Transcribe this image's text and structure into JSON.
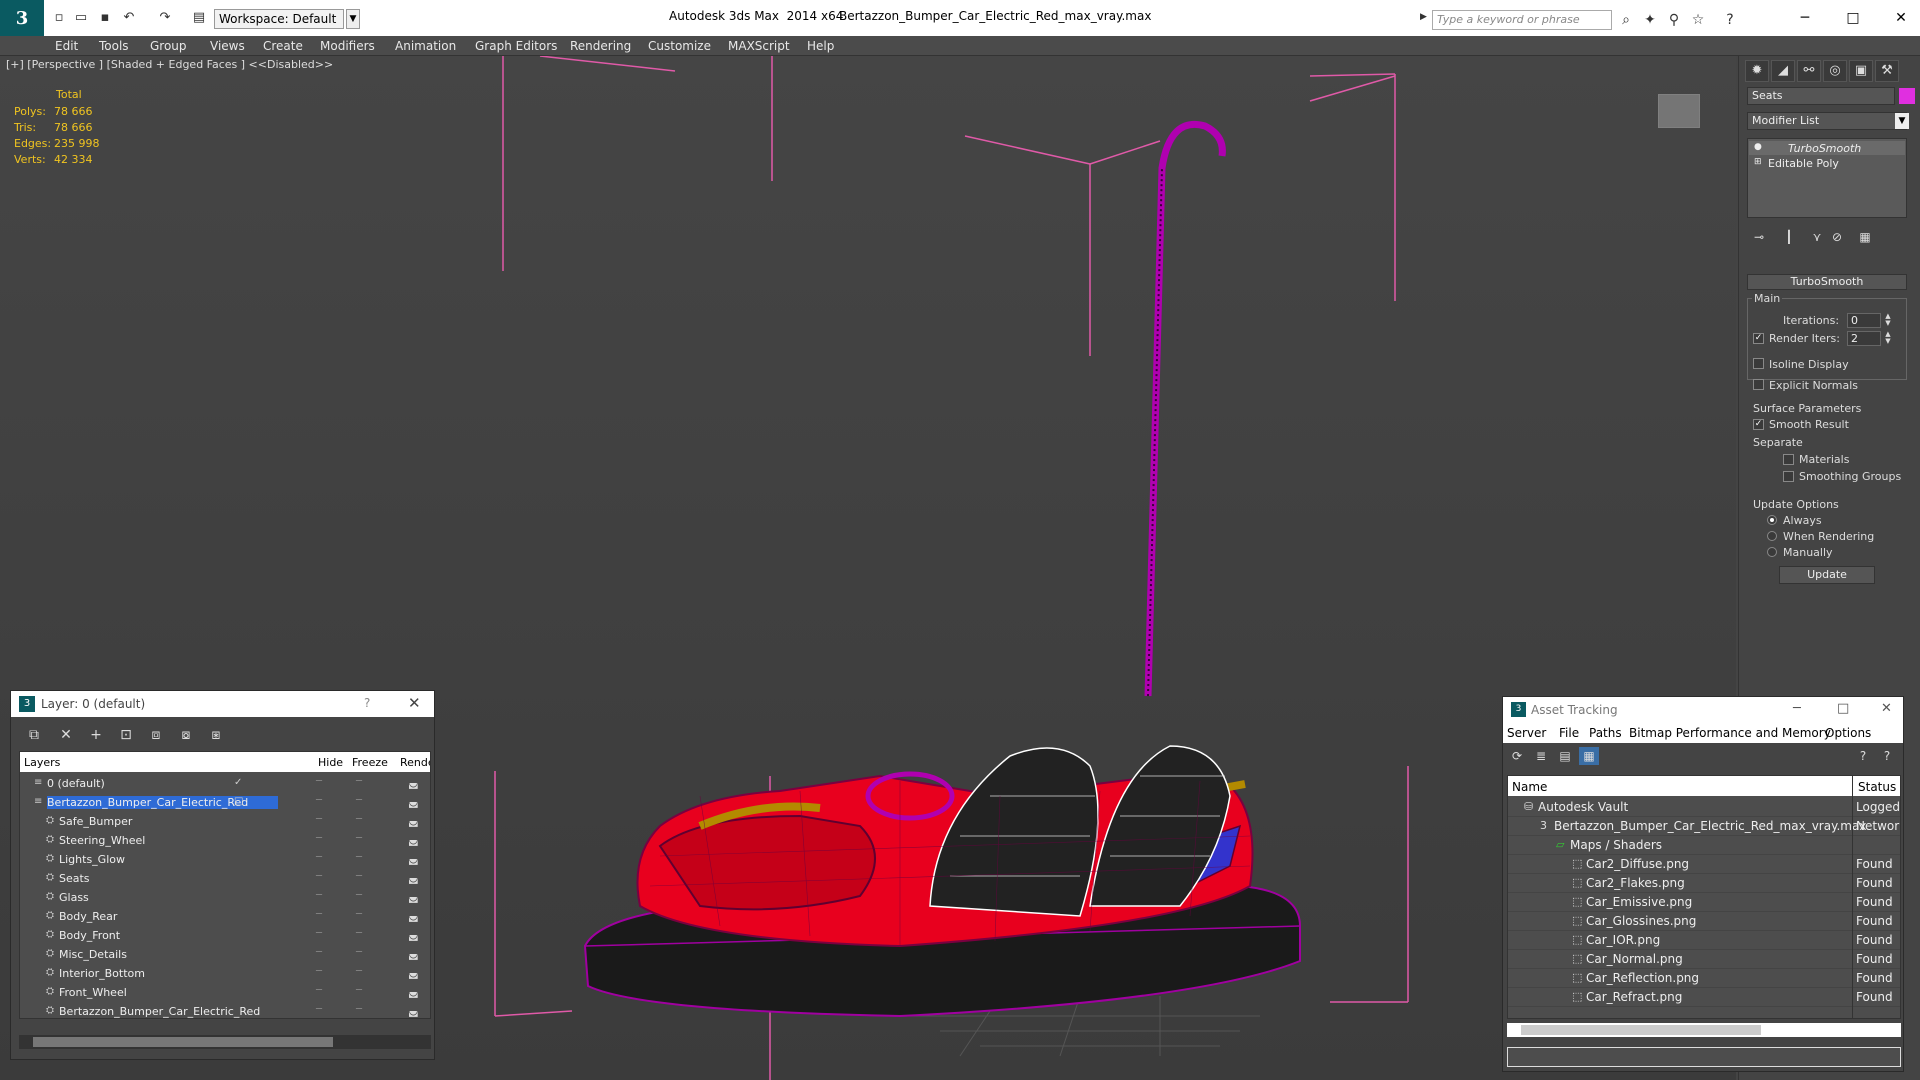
{
  "titlebar": {
    "workspace": "Workspace: Default",
    "app_title": "Autodesk 3ds Max  2014 x64",
    "file_name": "Bertazzon_Bumper_Car_Electric_Red_max_vray.max",
    "search_placeholder": "Type a keyword or phrase"
  },
  "menu": [
    "Edit",
    "Tools",
    "Group",
    "Views",
    "Create",
    "Modifiers",
    "Animation",
    "Graph Editors",
    "Rendering",
    "Customize",
    "MAXScript",
    "Help"
  ],
  "viewport": {
    "label": "[+] [Perspective ] [Shaded + Edged Faces ]  <<Disabled>>",
    "stats_total": "Total",
    "stats": [
      {
        "label": "Polys:",
        "value": "78 666"
      },
      {
        "label": "Tris:",
        "value": "78 666"
      },
      {
        "label": "Edges:",
        "value": "235 998"
      },
      {
        "label": "Verts:",
        "value": "42 334"
      }
    ]
  },
  "command_panel": {
    "object_name": "Seats",
    "object_color": "#e02fe0",
    "modifier_list": "Modifier List",
    "stack": [
      "TurboSmooth",
      "Editable Poly"
    ],
    "rollout_title": "TurboSmooth",
    "main_group": "Main",
    "iterations_label": "Iterations:",
    "iterations_value": "0",
    "render_iters_label": "Render Iters:",
    "render_iters_value": "2",
    "render_iters_checked": true,
    "isoline_label": "Isoline Display",
    "explicit_normals_label": "Explicit Normals",
    "surface_group": "Surface Parameters",
    "smooth_result_label": "Smooth Result",
    "smooth_result_checked": true,
    "separate_label": "Separate",
    "materials_label": "Materials",
    "smoothing_groups_label": "Smoothing Groups",
    "update_group": "Update Options",
    "update_options": [
      "Always",
      "When Rendering",
      "Manually"
    ],
    "update_selected": "Always",
    "update_button": "Update"
  },
  "layer_dialog": {
    "title": "Layer: 0 (default)",
    "help": "?",
    "columns": {
      "layers": "Layers",
      "hide": "Hide",
      "freeze": "Freeze",
      "render": "Render"
    },
    "rows": [
      {
        "name": "0 (default)",
        "level": 0,
        "active": true
      },
      {
        "name": "Bertazzon_Bumper_Car_Electric_Red",
        "level": 0,
        "selected": true
      },
      {
        "name": "Safe_Bumper",
        "level": 1
      },
      {
        "name": "Steering_Wheel",
        "level": 1
      },
      {
        "name": "Lights_Glow",
        "level": 1
      },
      {
        "name": "Seats",
        "level": 1
      },
      {
        "name": "Glass",
        "level": 1
      },
      {
        "name": "Body_Rear",
        "level": 1
      },
      {
        "name": "Body_Front",
        "level": 1
      },
      {
        "name": "Misc_Details",
        "level": 1
      },
      {
        "name": "Interior_Bottom",
        "level": 1
      },
      {
        "name": "Front_Wheel",
        "level": 1
      },
      {
        "name": "Bertazzon_Bumper_Car_Electric_Red",
        "level": 1
      }
    ]
  },
  "asset_dialog": {
    "title": "Asset Tracking",
    "menu": [
      "Server",
      "File",
      "Paths",
      "Bitmap Performance and Memory",
      "Options"
    ],
    "columns": {
      "name": "Name",
      "status": "Status"
    },
    "rows": [
      {
        "name": "Autodesk Vault",
        "status": "Logged C",
        "level": 0
      },
      {
        "name": "Bertazzon_Bumper_Car_Electric_Red_max_vray.max",
        "status": "Network I",
        "level": 1
      },
      {
        "name": "Maps / Shaders",
        "status": "",
        "level": 2
      },
      {
        "name": "Car2_Diffuse.png",
        "status": "Found",
        "level": 3
      },
      {
        "name": "Car2_Flakes.png",
        "status": "Found",
        "level": 3
      },
      {
        "name": "Car_Emissive.png",
        "status": "Found",
        "level": 3
      },
      {
        "name": "Car_Glossines.png",
        "status": "Found",
        "level": 3
      },
      {
        "name": "Car_IOR.png",
        "status": "Found",
        "level": 3
      },
      {
        "name": "Car_Normal.png",
        "status": "Found",
        "level": 3
      },
      {
        "name": "Car_Reflection.png",
        "status": "Found",
        "level": 3
      },
      {
        "name": "Car_Refract.png",
        "status": "Found",
        "level": 3
      }
    ]
  }
}
